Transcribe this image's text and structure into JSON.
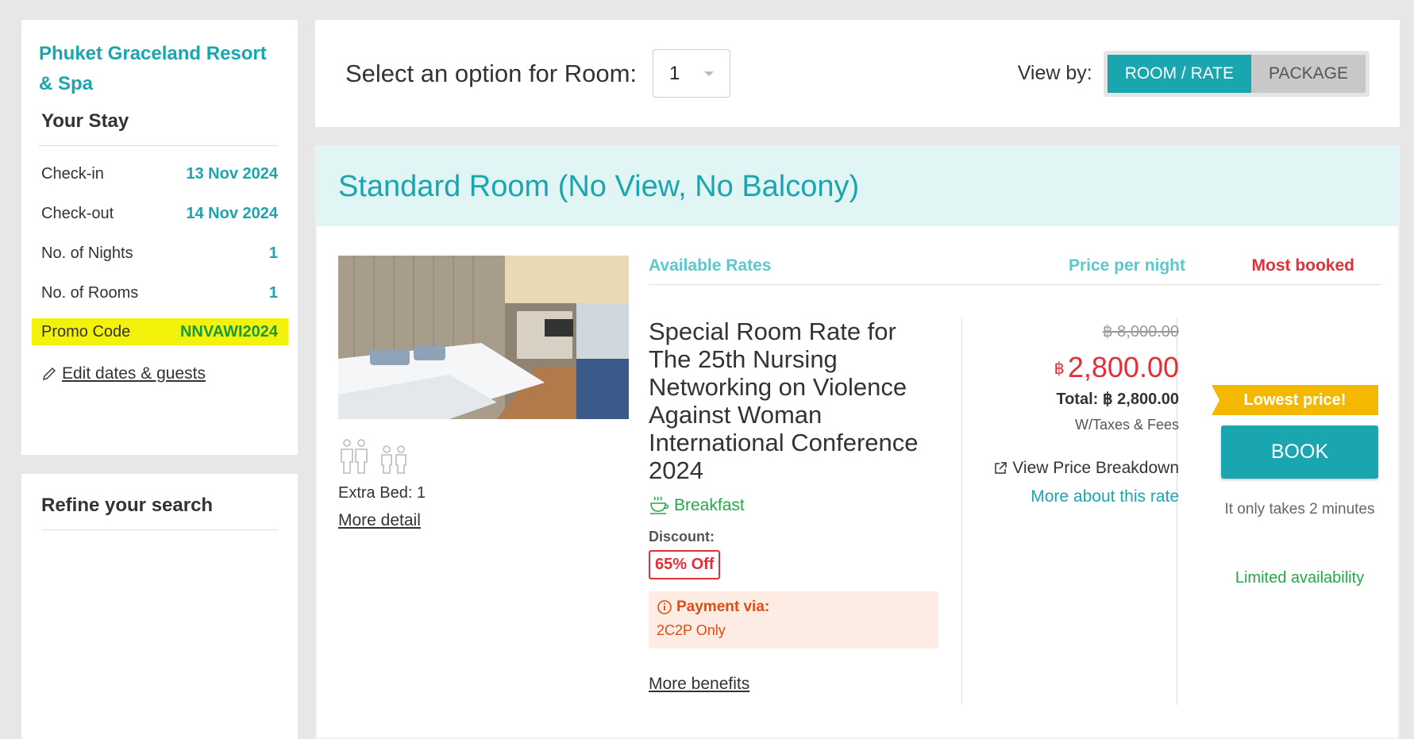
{
  "sidebar": {
    "hotel_name": "Phuket Graceland Resort & Spa",
    "your_stay_title": "Your Stay",
    "rows": [
      {
        "label": "Check-in",
        "value": "13 Nov 2024"
      },
      {
        "label": "Check-out",
        "value": "14 Nov 2024"
      },
      {
        "label": "No. of Nights",
        "value": "1"
      },
      {
        "label": "No. of Rooms",
        "value": "1"
      }
    ],
    "promo": {
      "label": "Promo Code",
      "value": "NNVAWI2024"
    },
    "edit_link": "Edit dates & guests",
    "refine_title": "Refine your search"
  },
  "topbar": {
    "select_label": "Select an option for Room:",
    "room_value": "1",
    "viewby_label": "View by:",
    "btn_room_rate": "ROOM / RATE",
    "btn_package": "PACKAGE"
  },
  "room": {
    "title": "Standard Room (No View, No Balcony)",
    "extra_bed": "Extra Bed: 1",
    "more_detail": "More detail",
    "headers": {
      "available_rates": "Available Rates",
      "price_per_night": "Price per night",
      "most_booked": "Most booked"
    },
    "rate": {
      "name": "Special Room Rate for The 25th Nursing Networking on Violence Against Woman International Conference 2024",
      "breakfast": "Breakfast",
      "discount_label": "Discount:",
      "discount_value": "65% Off",
      "payment_label": "Payment via:",
      "payment_value": "2C2P Only",
      "more_benefits": "More benefits"
    },
    "price": {
      "original": "฿ 8,000.00",
      "currency": "฿",
      "current": "2,800.00",
      "total": "Total: ฿ 2,800.00",
      "tax_note": "W/Taxes & Fees",
      "view_breakdown": "View Price Breakdown",
      "more_about": "More about this rate"
    },
    "book": {
      "badge": "Lowest price!",
      "button": "BOOK",
      "takes": "It only takes 2 minutes",
      "availability": "Limited availability"
    }
  },
  "colors": {
    "accent": "#1aa6ae",
    "price_red": "#e0303a",
    "badge_yellow": "#f5b800",
    "green": "#22a84a"
  }
}
